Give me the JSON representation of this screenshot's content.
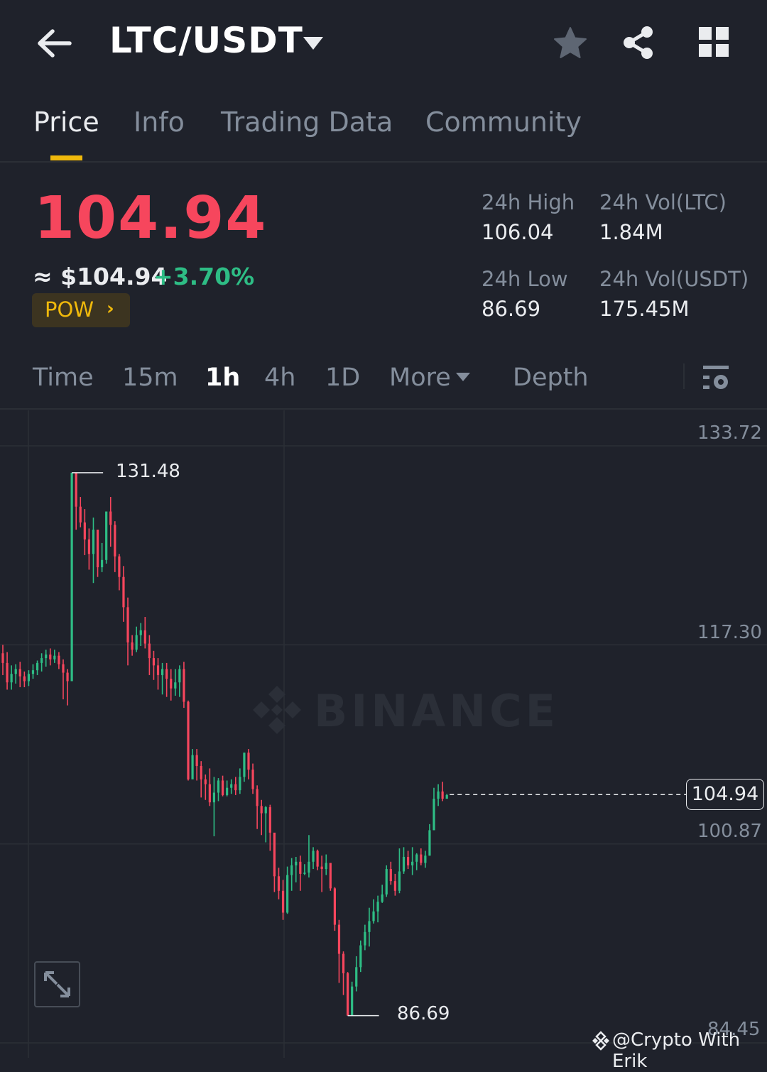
{
  "header": {
    "pair": "LTC/USDT",
    "icons": [
      "back-arrow-icon",
      "caret-down-icon",
      "star-icon",
      "share-icon",
      "grid-icon"
    ]
  },
  "tabs": [
    {
      "label": "Price",
      "active": true
    },
    {
      "label": "Info",
      "active": false
    },
    {
      "label": "Trading Data",
      "active": false
    },
    {
      "label": "Community",
      "active": false
    }
  ],
  "ticker": {
    "last_price": "104.94",
    "approx_usd": "≈ $104.94",
    "change_pct": "+3.70%",
    "tag": "POW",
    "stats": {
      "high_label": "24h High",
      "high_value": "106.04",
      "vol_ltc_label": "24h Vol(LTC)",
      "vol_ltc_value": "1.84M",
      "low_label": "24h Low",
      "low_value": "86.69",
      "vol_usdt_label": "24h Vol(USDT)",
      "vol_usdt_value": "175.45M"
    }
  },
  "intervals": {
    "time": "Time",
    "m15": "15m",
    "h1": "1h",
    "h4": "4h",
    "d1": "1D",
    "more": "More",
    "depth": "Depth",
    "active": "1h"
  },
  "colors": {
    "up": "#2ebd85",
    "down": "#f6465d",
    "accent": "#f0b90b",
    "background": "#1f222b"
  },
  "chart_data": {
    "type": "candlestick",
    "interval": "1h",
    "y_ticks": [
      "133.72",
      "117.30",
      "100.87",
      "84.45"
    ],
    "ylim": [
      84.45,
      133.72
    ],
    "high_marker": "131.48",
    "low_marker": "86.69",
    "current_price": "104.94",
    "candles": [
      [
        116.6,
        115.8,
        117.3,
        114.8
      ],
      [
        115.8,
        114.2,
        116.7,
        113.6
      ],
      [
        114.2,
        114.9,
        115.6,
        113.6
      ],
      [
        114.9,
        115.3,
        115.7,
        114.1
      ],
      [
        115.3,
        114.7,
        115.9,
        113.8
      ],
      [
        114.7,
        114.3,
        115.1,
        113.8
      ],
      [
        114.3,
        114.9,
        115.2,
        113.9
      ],
      [
        114.9,
        115.2,
        115.7,
        114.5
      ],
      [
        115.2,
        115.8,
        116.0,
        114.8
      ],
      [
        115.8,
        116.2,
        116.6,
        115.1
      ],
      [
        116.2,
        116.5,
        116.9,
        115.5
      ],
      [
        116.5,
        116.1,
        117.0,
        115.6
      ],
      [
        116.1,
        116.4,
        116.9,
        115.8
      ],
      [
        116.4,
        115.7,
        116.7,
        115.3
      ],
      [
        115.7,
        115.0,
        116.1,
        112.8
      ],
      [
        115.0,
        114.3,
        115.3,
        112.3
      ],
      [
        114.3,
        131.5,
        131.5,
        114.3
      ],
      [
        131.5,
        128.7,
        130.2,
        126.8
      ],
      [
        128.7,
        127.4,
        129.5,
        127.0
      ],
      [
        127.4,
        126.0,
        128.5,
        124.7
      ],
      [
        126.0,
        124.8,
        126.9,
        123.5
      ],
      [
        124.8,
        126.8,
        127.8,
        122.4
      ],
      [
        126.8,
        123.7,
        126.8,
        122.9
      ],
      [
        123.7,
        124.3,
        125.7,
        123.3
      ],
      [
        124.3,
        128.3,
        128.3,
        124.0
      ],
      [
        128.3,
        127.2,
        129.5,
        125.4
      ],
      [
        127.2,
        124.6,
        127.5,
        123.3
      ],
      [
        124.6,
        122.9,
        124.8,
        121.8
      ],
      [
        122.9,
        120.4,
        123.8,
        119.2
      ],
      [
        120.4,
        117.5,
        121.2,
        115.6
      ],
      [
        117.5,
        116.9,
        118.1,
        116.4
      ],
      [
        116.9,
        118.1,
        118.8,
        116.7
      ],
      [
        118.1,
        118.5,
        119.1,
        117.2
      ],
      [
        118.5,
        117.4,
        119.6,
        117.0
      ],
      [
        117.4,
        116.2,
        118.1,
        114.8
      ],
      [
        116.2,
        115.6,
        116.8,
        114.4
      ],
      [
        115.6,
        114.8,
        116.2,
        113.6
      ],
      [
        114.8,
        115.3,
        115.8,
        113.2
      ],
      [
        115.3,
        114.5,
        115.8,
        113.0
      ],
      [
        114.5,
        113.7,
        115.3,
        112.7
      ],
      [
        113.7,
        114.2,
        115.3,
        113.1
      ],
      [
        114.2,
        115.3,
        115.6,
        113.0
      ],
      [
        115.3,
        112.6,
        115.9,
        112.1
      ],
      [
        112.6,
        106.2,
        112.7,
        106.1
      ],
      [
        106.2,
        108.2,
        108.7,
        106.4
      ],
      [
        108.2,
        107.3,
        108.7,
        106.1
      ],
      [
        107.3,
        106.2,
        107.7,
        104.7
      ],
      [
        106.2,
        105.8,
        106.6,
        104.5
      ],
      [
        105.8,
        104.3,
        107.1,
        104.0
      ],
      [
        104.3,
        105.1,
        106.4,
        101.5
      ],
      [
        105.1,
        106.1,
        106.3,
        104.4
      ],
      [
        106.1,
        104.9,
        106.5,
        104.8
      ],
      [
        104.9,
        105.5,
        106.1,
        104.8
      ],
      [
        105.5,
        105.8,
        106.2,
        105.0
      ],
      [
        105.8,
        105.3,
        106.4,
        104.9
      ],
      [
        105.3,
        106.4,
        107.1,
        105.0
      ],
      [
        106.4,
        108.4,
        108.4,
        106.0
      ],
      [
        108.4,
        107.0,
        108.7,
        106.2
      ],
      [
        107.0,
        105.4,
        107.5,
        105.0
      ],
      [
        105.4,
        104.0,
        105.7,
        102.1
      ],
      [
        104.0,
        103.4,
        104.5,
        101.6
      ],
      [
        103.4,
        103.9,
        104.0,
        101.0
      ],
      [
        103.9,
        101.8,
        104.1,
        100.3
      ],
      [
        101.8,
        98.2,
        101.4,
        96.9
      ],
      [
        98.2,
        97.0,
        98.9,
        96.3
      ],
      [
        97.0,
        95.2,
        97.9,
        94.6
      ],
      [
        95.2,
        98.3,
        99.0,
        95.1
      ],
      [
        98.3,
        99.1,
        99.7,
        97.0
      ],
      [
        99.1,
        99.4,
        99.8,
        97.7
      ],
      [
        99.4,
        98.4,
        99.9,
        97.0
      ],
      [
        98.4,
        98.5,
        99.2,
        98.3
      ],
      [
        98.5,
        99.4,
        101.6,
        98.1
      ],
      [
        99.4,
        100.3,
        100.6,
        98.8
      ],
      [
        100.3,
        99.0,
        100.4,
        98.7
      ],
      [
        99.0,
        98.8,
        99.9,
        96.9
      ],
      [
        98.8,
        99.3,
        100.0,
        98.3
      ],
      [
        99.3,
        97.2,
        99.3,
        97.0
      ],
      [
        97.2,
        94.2,
        97.3,
        93.7
      ],
      [
        94.2,
        91.8,
        94.6,
        89.4
      ],
      [
        91.8,
        90.2,
        92.0,
        88.4
      ],
      [
        90.2,
        86.7,
        90.3,
        86.7
      ],
      [
        86.7,
        89.1,
        89.5,
        86.7
      ],
      [
        89.1,
        90.7,
        91.6,
        88.7
      ],
      [
        90.7,
        92.5,
        92.9,
        90.3
      ],
      [
        92.5,
        93.6,
        94.2,
        92.1
      ],
      [
        93.6,
        94.5,
        95.6,
        92.4
      ],
      [
        94.5,
        95.3,
        96.3,
        94.3
      ],
      [
        95.3,
        96.1,
        96.6,
        94.4
      ],
      [
        96.1,
        96.7,
        97.5,
        96.0
      ],
      [
        96.7,
        98.8,
        99.1,
        96.5
      ],
      [
        98.8,
        97.8,
        99.4,
        97.5
      ],
      [
        97.8,
        97.0,
        98.4,
        96.6
      ],
      [
        97.0,
        98.6,
        100.5,
        96.8
      ],
      [
        98.6,
        99.8,
        100.6,
        98.4
      ],
      [
        99.8,
        99.1,
        100.3,
        98.8
      ],
      [
        99.1,
        99.4,
        100.6,
        98.3
      ],
      [
        99.4,
        100.0,
        100.1,
        98.7
      ],
      [
        100.0,
        99.3,
        100.5,
        99.1
      ],
      [
        99.3,
        99.9,
        100.3,
        98.9
      ],
      [
        99.9,
        102.0,
        102.5,
        99.9
      ],
      [
        102.0,
        104.6,
        105.5,
        102.0
      ],
      [
        104.6,
        105.2,
        105.8,
        104.0
      ],
      [
        105.2,
        104.6,
        106.0,
        104.4
      ],
      [
        104.6,
        104.9,
        105.0,
        104.6
      ]
    ]
  },
  "watermark": "BINANCE",
  "credit": "@Crypto With Erik"
}
